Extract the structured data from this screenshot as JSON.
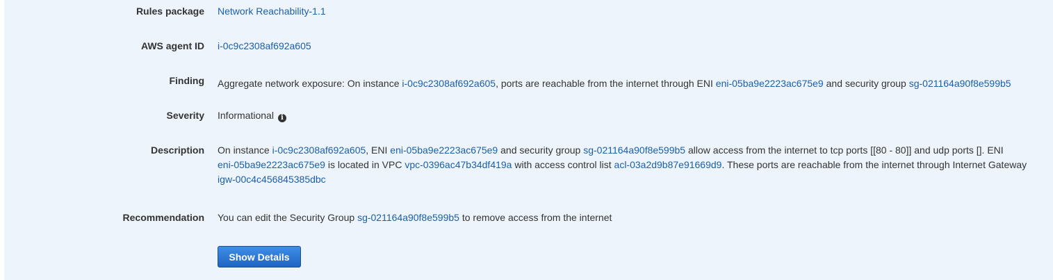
{
  "rules_package": {
    "label": "Rules package",
    "value": "Network Reachability-1.1"
  },
  "agent_id": {
    "label": "AWS agent ID",
    "value": "i-0c9c2308af692a605"
  },
  "finding": {
    "label": "Finding",
    "text1": "Aggregate network exposure: On instance ",
    "instance": "i-0c9c2308af692a605",
    "text2": ", ports are reachable from the internet through ENI ",
    "eni": "eni-05ba9e2223ac675e9",
    "text3": " and security group ",
    "sg": "sg-021164a90f8e599b5"
  },
  "severity": {
    "label": "Severity",
    "value": "Informational",
    "icon": "info-icon"
  },
  "description": {
    "label": "Description",
    "t1": "On instance ",
    "instance": "i-0c9c2308af692a605",
    "t2": ", ENI ",
    "eni": "eni-05ba9e2223ac675e9",
    "t3": " and security group ",
    "sg": "sg-021164a90f8e599b5",
    "t4": " allow access from the internet to tcp ports [[80 - 80]] and udp ports []. ENI",
    "eni2": "eni-05ba9e2223ac675e9",
    "t5": " is located in VPC ",
    "vpc": "vpc-0396ac47b34df419a",
    "t6": " with access control list ",
    "acl": "acl-03a2d9b87e91669d9",
    "t7": ". These ports are reachable from the internet through Internet Gateway",
    "igw": "igw-00c4c456845385dbc"
  },
  "recommendation": {
    "label": "Recommendation",
    "t1": "You can edit the Security Group ",
    "sg": "sg-021164a90f8e599b5",
    "t2": " to remove access from the internet"
  },
  "actions": {
    "show_details": "Show Details"
  },
  "colors": {
    "panel_bg": "#eef4fb",
    "link": "#1a5fa8",
    "button": "#1f64c4"
  }
}
